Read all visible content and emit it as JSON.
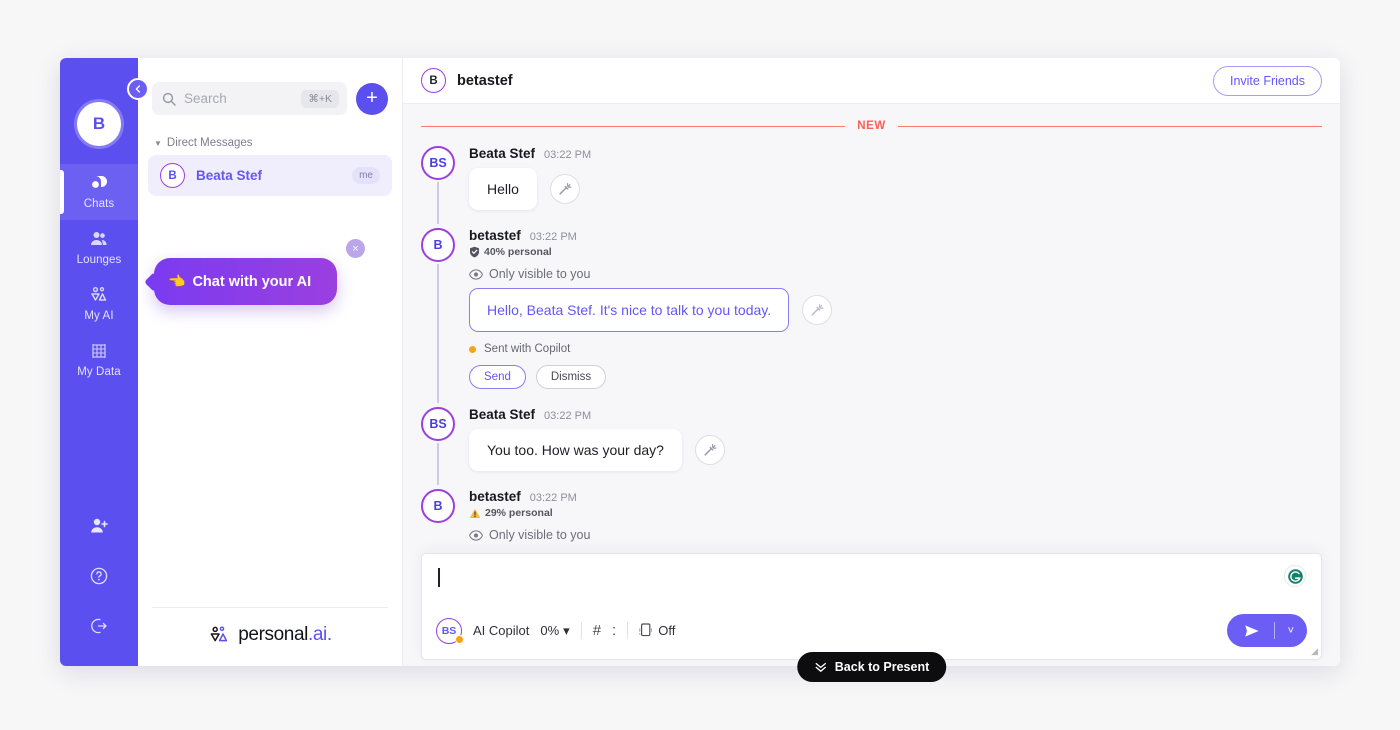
{
  "rail": {
    "avatar_initial": "B",
    "collapse_icon": "chevron-left-icon",
    "items": [
      {
        "label": "Chats",
        "icon": "chat-bubble-icon",
        "active": true
      },
      {
        "label": "Lounges",
        "icon": "people-icon",
        "active": false
      },
      {
        "label": "My AI",
        "icon": "personal-ai-mark-icon",
        "active": false
      },
      {
        "label": "My Data",
        "icon": "grid-data-icon",
        "active": false
      }
    ],
    "bottom_icons": [
      "add-person-icon",
      "help-circle-icon",
      "logout-icon"
    ]
  },
  "panel": {
    "search": {
      "placeholder": "Search",
      "shortcut": "⌘+K",
      "icon": "search-icon"
    },
    "add_button_label": "+",
    "section": {
      "label": "Direct Messages",
      "caret": "▼"
    },
    "dm_items": [
      {
        "initial": "B",
        "name": "Beata Stef",
        "badge": "me"
      }
    ],
    "tooltip": {
      "emoji": "👈",
      "text": "Chat with your AI",
      "close": "×"
    },
    "brand": {
      "name": "personal",
      "suffix": ".ai",
      "dot": "."
    }
  },
  "main": {
    "header": {
      "avatar_initial": "B",
      "title": "betastef",
      "invite_label": "Invite Friends"
    },
    "new_divider_label": "NEW",
    "messages": [
      {
        "avatar": "BS",
        "name": "Beata Stef",
        "time": "03:22 PM",
        "bubble": "Hello",
        "type": "user"
      },
      {
        "avatar": "B",
        "name": "betastef",
        "time": "03:22 PM",
        "score": "40% personal",
        "score_icon": "shield-check-icon",
        "visibility": "Only visible to you",
        "bubble": "Hello, Beata Stef. It's nice to talk to you today.",
        "copilot_note": "Sent with Copilot",
        "send_label": "Send",
        "dismiss_label": "Dismiss",
        "type": "ai"
      },
      {
        "avatar": "BS",
        "name": "Beata Stef",
        "time": "03:22 PM",
        "bubble": "You too. How was your day?",
        "type": "user"
      },
      {
        "avatar": "B",
        "name": "betastef",
        "time": "03:22 PM",
        "score": "29% personal",
        "score_icon": "warning-triangle-icon",
        "visibility": "Only visible to you",
        "type": "ai-partial"
      }
    ],
    "composer": {
      "value": "",
      "grammarly_icon": "grammarly-icon",
      "copilot_label": "AI Copilot",
      "copilot_percent": "0%",
      "copilot_caret": "▾",
      "avatar": "BS",
      "hash_icon": "#",
      "colon_icon": ":",
      "device_label": "Off",
      "device_icon": "device-icon",
      "send_icon": "send-plane-icon",
      "send_caret": "˅"
    },
    "back_to_present": {
      "icon": "⌄⌄",
      "label": "Back to Present"
    }
  }
}
